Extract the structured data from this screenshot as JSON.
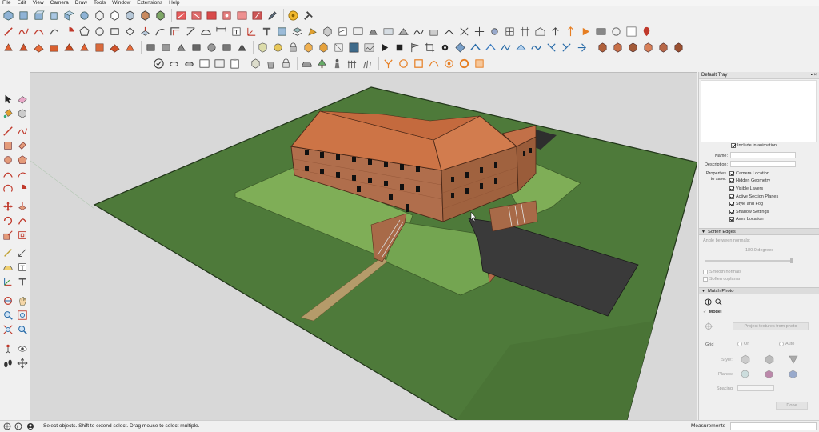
{
  "menu": [
    "File",
    "Edit",
    "View",
    "Camera",
    "Draw",
    "Tools",
    "Window",
    "Extensions",
    "Help"
  ],
  "tray": {
    "title": "Default Tray",
    "scenes": {
      "include_in_animation": "Include in animation",
      "name_label": "Name:",
      "description_label": "Description:",
      "properties_label_1": "Properties",
      "properties_label_2": "to save:",
      "properties": [
        "Camera Location",
        "Hidden Geometry",
        "Visible Layers",
        "Active Section Planes",
        "Style and Fog",
        "Shadow Settings",
        "Axes Location"
      ]
    },
    "soften_edges": {
      "title": "Soften Edges",
      "angle_label": "Angle between normals:",
      "angle_value": "180.0  degrees",
      "smooth_normals": "Smooth normals",
      "soften_coplanar": "Soften coplanar"
    },
    "match_photo": {
      "title": "Match Photo",
      "model_label": "Model",
      "project_button": "Project textures from photo",
      "grid_label": "Grid",
      "grid_on": "On",
      "grid_auto": "Auto",
      "style_label": "Style:",
      "planes_label": "Planes:",
      "spacing_label": "Spacing:",
      "done_button": "Done"
    }
  },
  "status": {
    "message": "Select objects. Shift to extend select. Drag mouse to select multiple.",
    "measurements_label": "Measurements"
  },
  "colors": {
    "ground": "#4f7a3a",
    "lawn": "#7bab56",
    "roof": "#cc7448",
    "wall": "#a86c4a",
    "road": "#3a3a3a",
    "path": "#b29a6a",
    "sky": "#d8d8d8"
  }
}
